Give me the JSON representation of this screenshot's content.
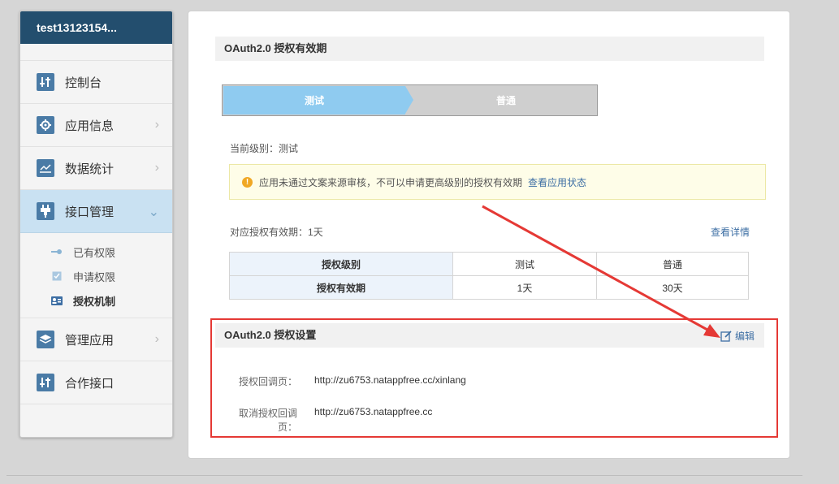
{
  "sidebar": {
    "user": "test13123154...",
    "items": [
      {
        "label": "控制台",
        "icon": "sliders-icon"
      },
      {
        "label": "应用信息",
        "icon": "gear-icon"
      },
      {
        "label": "数据统计",
        "icon": "chart-icon"
      },
      {
        "label": "接口管理",
        "icon": "plug-icon"
      },
      {
        "label": "管理应用",
        "icon": "layers-icon"
      },
      {
        "label": "合作接口",
        "icon": "sliders-icon"
      }
    ],
    "sub_items": [
      {
        "label": "已有权限",
        "icon": "key-icon"
      },
      {
        "label": "申请权限",
        "icon": "checkbox-icon"
      },
      {
        "label": "授权机制",
        "icon": "id-card-icon"
      }
    ]
  },
  "main": {
    "validity_section_title": "OAuth2.0 授权有效期",
    "steps": [
      "测试",
      "普通"
    ],
    "current_level_label": "当前级别：",
    "current_level_value": "测试",
    "notice_text": "应用未通过文案来源审核，不可以申请更高级别的授权有效期",
    "notice_link": "查看应用状态",
    "validity_label": "对应授权有效期：",
    "validity_value": "1天",
    "details_link": "查看详情",
    "table": {
      "row1": {
        "header": "授权级别",
        "c1": "测试",
        "c2": "普通"
      },
      "row2": {
        "header": "授权有效期",
        "c1": "1天",
        "c2": "30天"
      }
    },
    "settings_section_title": "OAuth2.0 授权设置",
    "edit_label": "编辑",
    "callback_label": "授权回调页：",
    "callback_value": "http://zu6753.natappfree.cc/xinlang",
    "cancel_callback_label": "取消授权回调页：",
    "cancel_callback_value": "http://zu6753.natappfree.cc"
  },
  "colors": {
    "sidebar_header": "#234e6e",
    "active_item": "#c9e1f2",
    "step_active": "#8fcbf0",
    "annotation_red": "#e53935",
    "link": "#3e6fa4"
  }
}
